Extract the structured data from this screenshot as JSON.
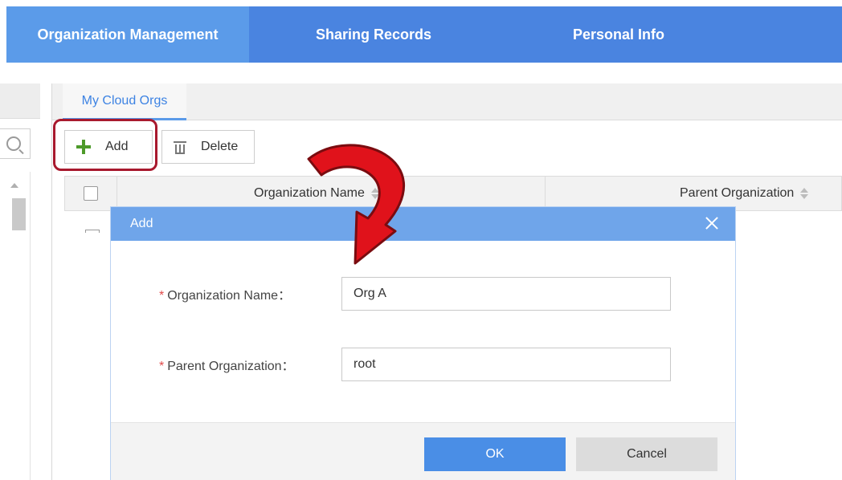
{
  "nav": {
    "tabs": [
      {
        "label": "Organization Management",
        "active": true
      },
      {
        "label": "Sharing Records",
        "active": false
      },
      {
        "label": "Personal Info",
        "active": false
      }
    ]
  },
  "panel": {
    "tab_label": "My Cloud Orgs"
  },
  "toolbar": {
    "add_label": "Add",
    "delete_label": "Delete"
  },
  "table": {
    "columns": [
      "Organization Name",
      "Parent Organization"
    ]
  },
  "modal": {
    "title": "Add",
    "fields": [
      {
        "required_mark": "*",
        "label": "Organization Name：",
        "value": "Org A"
      },
      {
        "required_mark": "*",
        "label": "Parent Organization：",
        "value": "root"
      }
    ],
    "ok_label": "OK",
    "cancel_label": "Cancel"
  },
  "icons": {
    "add": "plus-icon",
    "delete": "trash-icon",
    "search": "search-icon",
    "close": "close-icon",
    "sort": "sort-icon",
    "annotation": "curved-arrow-icon"
  },
  "colors": {
    "nav_bg": "#4a84e0",
    "nav_active": "#5b9be9",
    "modal_header": "#6fa5ea",
    "primary_button": "#4a8ee6",
    "highlight_border": "#a8192e",
    "annotation_arrow": "#e0121b",
    "required": "#e14b4b"
  }
}
